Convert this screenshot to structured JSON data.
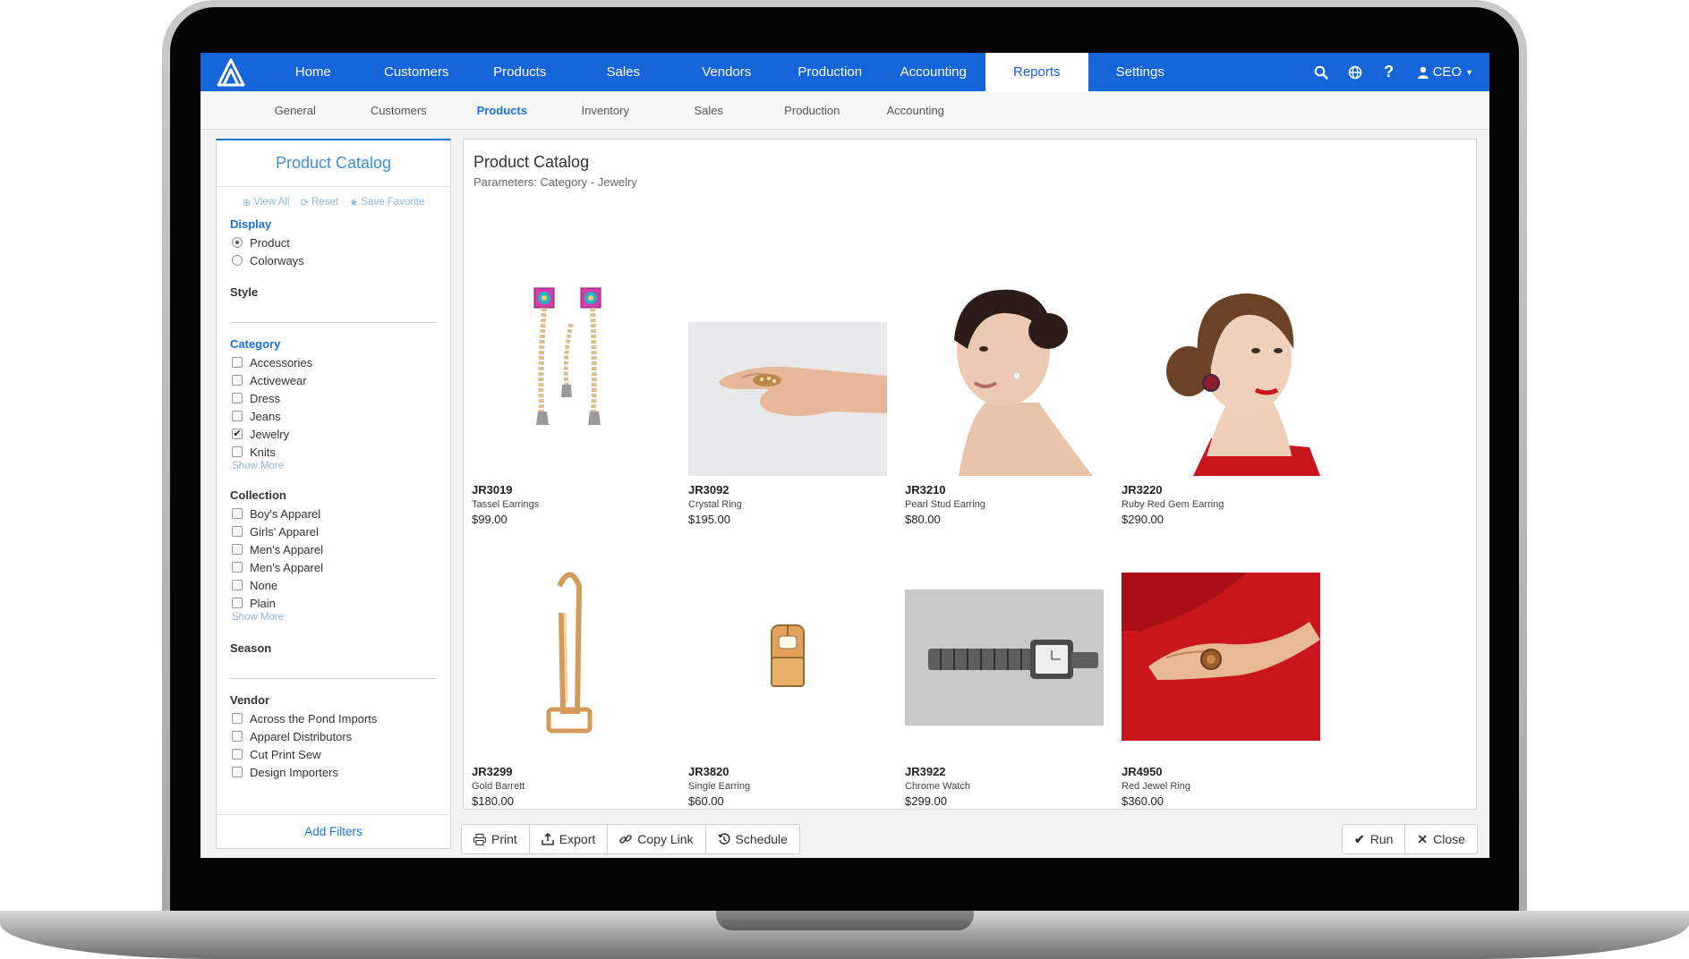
{
  "nav": {
    "items": [
      {
        "label": "Home"
      },
      {
        "label": "Customers"
      },
      {
        "label": "Products"
      },
      {
        "label": "Sales"
      },
      {
        "label": "Vendors"
      },
      {
        "label": "Production"
      },
      {
        "label": "Accounting"
      },
      {
        "label": "Reports",
        "active": true
      },
      {
        "label": "Settings"
      }
    ],
    "user_label": "CEO",
    "icons": [
      "search-icon",
      "globe-icon",
      "help-icon",
      "user-icon"
    ]
  },
  "subnav": {
    "items": [
      {
        "label": "General"
      },
      {
        "label": "Customers"
      },
      {
        "label": "Products",
        "active": true
      },
      {
        "label": "Inventory"
      },
      {
        "label": "Sales"
      },
      {
        "label": "Production"
      },
      {
        "label": "Accounting"
      }
    ]
  },
  "filters": {
    "title": "Product Catalog",
    "actions": {
      "view_all": "View All",
      "reset": "Reset",
      "save_favorite": "Save Favorite"
    },
    "display": {
      "title": "Display",
      "options": [
        {
          "label": "Product",
          "selected": true
        },
        {
          "label": "Colorways",
          "selected": false
        }
      ]
    },
    "style": {
      "title": "Style"
    },
    "category": {
      "title": "Category",
      "options": [
        {
          "label": "Accessories",
          "checked": false
        },
        {
          "label": "Activewear",
          "checked": false
        },
        {
          "label": "Dress",
          "checked": false
        },
        {
          "label": "Jeans",
          "checked": false
        },
        {
          "label": "Jewelry",
          "checked": true
        },
        {
          "label": "Knits",
          "checked": false
        }
      ],
      "show_more": "Show More"
    },
    "collection": {
      "title": "Collection",
      "options": [
        {
          "label": "Boy's Apparel",
          "checked": false
        },
        {
          "label": "Girls' Apparel",
          "checked": false
        },
        {
          "label": "Men's Apparel",
          "checked": false
        },
        {
          "label": "Men's Apparel",
          "checked": false
        },
        {
          "label": "None",
          "checked": false
        },
        {
          "label": "Plain",
          "checked": false
        }
      ],
      "show_more": "Show More"
    },
    "season": {
      "title": "Season"
    },
    "vendor": {
      "title": "Vendor",
      "options": [
        {
          "label": "Across the Pond Imports",
          "checked": false
        },
        {
          "label": "Apparel Distributors",
          "checked": false
        },
        {
          "label": "Cut Print Sew",
          "checked": false
        },
        {
          "label": "Design Importers",
          "checked": false
        }
      ]
    },
    "add_filters": "Add Filters"
  },
  "report": {
    "title": "Product Catalog",
    "params": "Parameters: Category - Jewelry",
    "products": [
      {
        "sku": "JR3019",
        "name": "Tassel Earrings",
        "price": "$99.00",
        "image": "tassel-earrings-image"
      },
      {
        "sku": "JR3092",
        "name": "Crystal Ring",
        "price": "$195.00",
        "image": "crystal-ring-image"
      },
      {
        "sku": "JR3210",
        "name": "Pearl Stud Earring",
        "price": "$80.00",
        "image": "pearl-stud-earring-image"
      },
      {
        "sku": "JR3220",
        "name": "Ruby Red Gem Earring",
        "price": "$290.00",
        "image": "ruby-red-gem-earring-image"
      },
      {
        "sku": "JR3299",
        "name": "Gold Barrett",
        "price": "$180.00",
        "image": "gold-barrett-image"
      },
      {
        "sku": "JR3820",
        "name": "Single Earring",
        "price": "$60.00",
        "image": "single-earring-image"
      },
      {
        "sku": "JR3922",
        "name": "Chrome Watch",
        "price": "$299.00",
        "image": "chrome-watch-image"
      },
      {
        "sku": "JR4950",
        "name": "Red Jewel Ring",
        "price": "$360.00",
        "image": "red-jewel-ring-image"
      }
    ]
  },
  "toolbar": {
    "print": "Print",
    "export": "Export",
    "copy_link": "Copy Link",
    "schedule": "Schedule",
    "run": "Run",
    "close": "Close"
  },
  "colors": {
    "brand": "#1565d8",
    "link": "#1a73d9",
    "accent_red": "#c8161c"
  }
}
